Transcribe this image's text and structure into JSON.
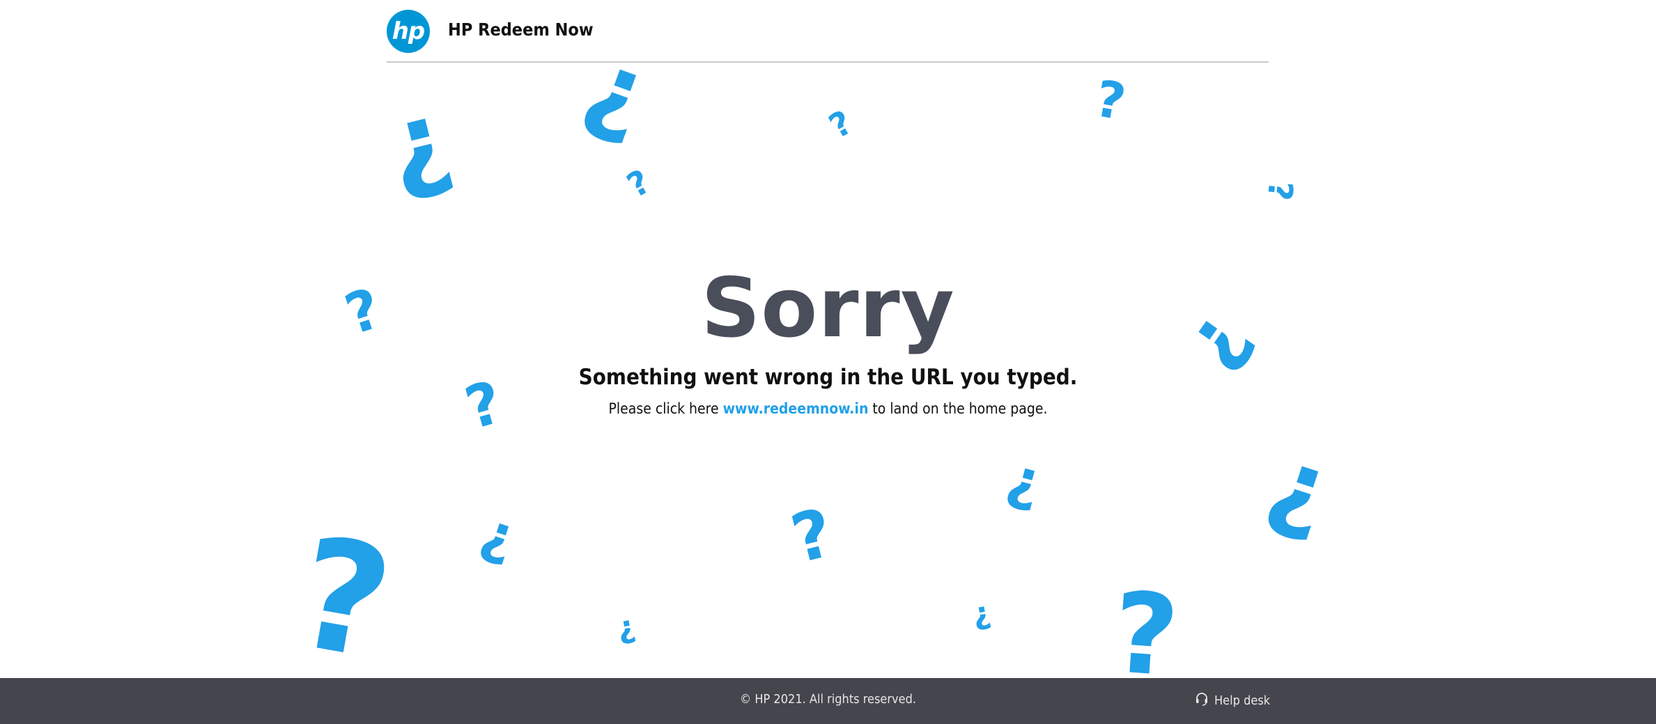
{
  "header": {
    "logo_text": "hp",
    "brand": "HP Redeem Now"
  },
  "main": {
    "title": "Sorry",
    "subtitle": "Something went wrong in the URL you typed.",
    "line_before": "Please click here ",
    "link_text": "www.redeemnow.in",
    "line_after": " to land on the home page."
  },
  "footer": {
    "copyright": "© HP 2021. All rights reserved.",
    "help_label": "Help desk"
  },
  "decor": {
    "glyph_a": "?",
    "glyph_b": "¿",
    "color": "#22a0e8"
  },
  "colors": {
    "brand_blue": "#0096d6",
    "title_gray": "#4a4e5a",
    "footer_bg": "#45454d"
  },
  "icons": [
    "hp-logo-icon",
    "headset-icon",
    "question-mark-icon"
  ]
}
